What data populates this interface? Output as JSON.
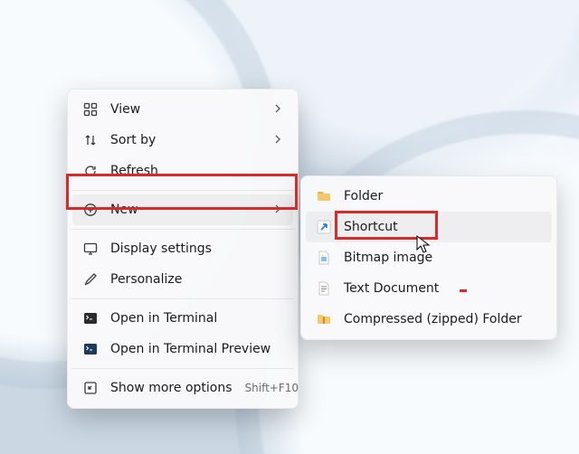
{
  "primary_menu": {
    "items": [
      {
        "icon": "view",
        "label": "View",
        "sub": true
      },
      {
        "icon": "sort",
        "label": "Sort by",
        "sub": true
      },
      {
        "icon": "refresh",
        "label": "Refresh"
      },
      {
        "sep": true
      },
      {
        "icon": "new",
        "label": "New",
        "sub": true,
        "hover": true,
        "highlight": true
      },
      {
        "sep": true
      },
      {
        "icon": "display",
        "label": "Display settings"
      },
      {
        "icon": "personalize",
        "label": "Personalize"
      },
      {
        "sep": true
      },
      {
        "icon": "terminal",
        "label": "Open in Terminal"
      },
      {
        "icon": "terminal-pre",
        "label": "Open in Terminal Preview"
      },
      {
        "sep": true
      },
      {
        "icon": "more",
        "label": "Show more options",
        "accel": "Shift+F10"
      }
    ]
  },
  "secondary_menu": {
    "items": [
      {
        "icon": "folder",
        "label": "Folder"
      },
      {
        "icon": "shortcut",
        "label": "Shortcut",
        "hover": true,
        "highlight": true
      },
      {
        "icon": "bitmap",
        "label": "Bitmap image"
      },
      {
        "icon": "text",
        "label": "Text Document"
      },
      {
        "icon": "zip",
        "label": "Compressed (zipped) Folder"
      }
    ]
  }
}
